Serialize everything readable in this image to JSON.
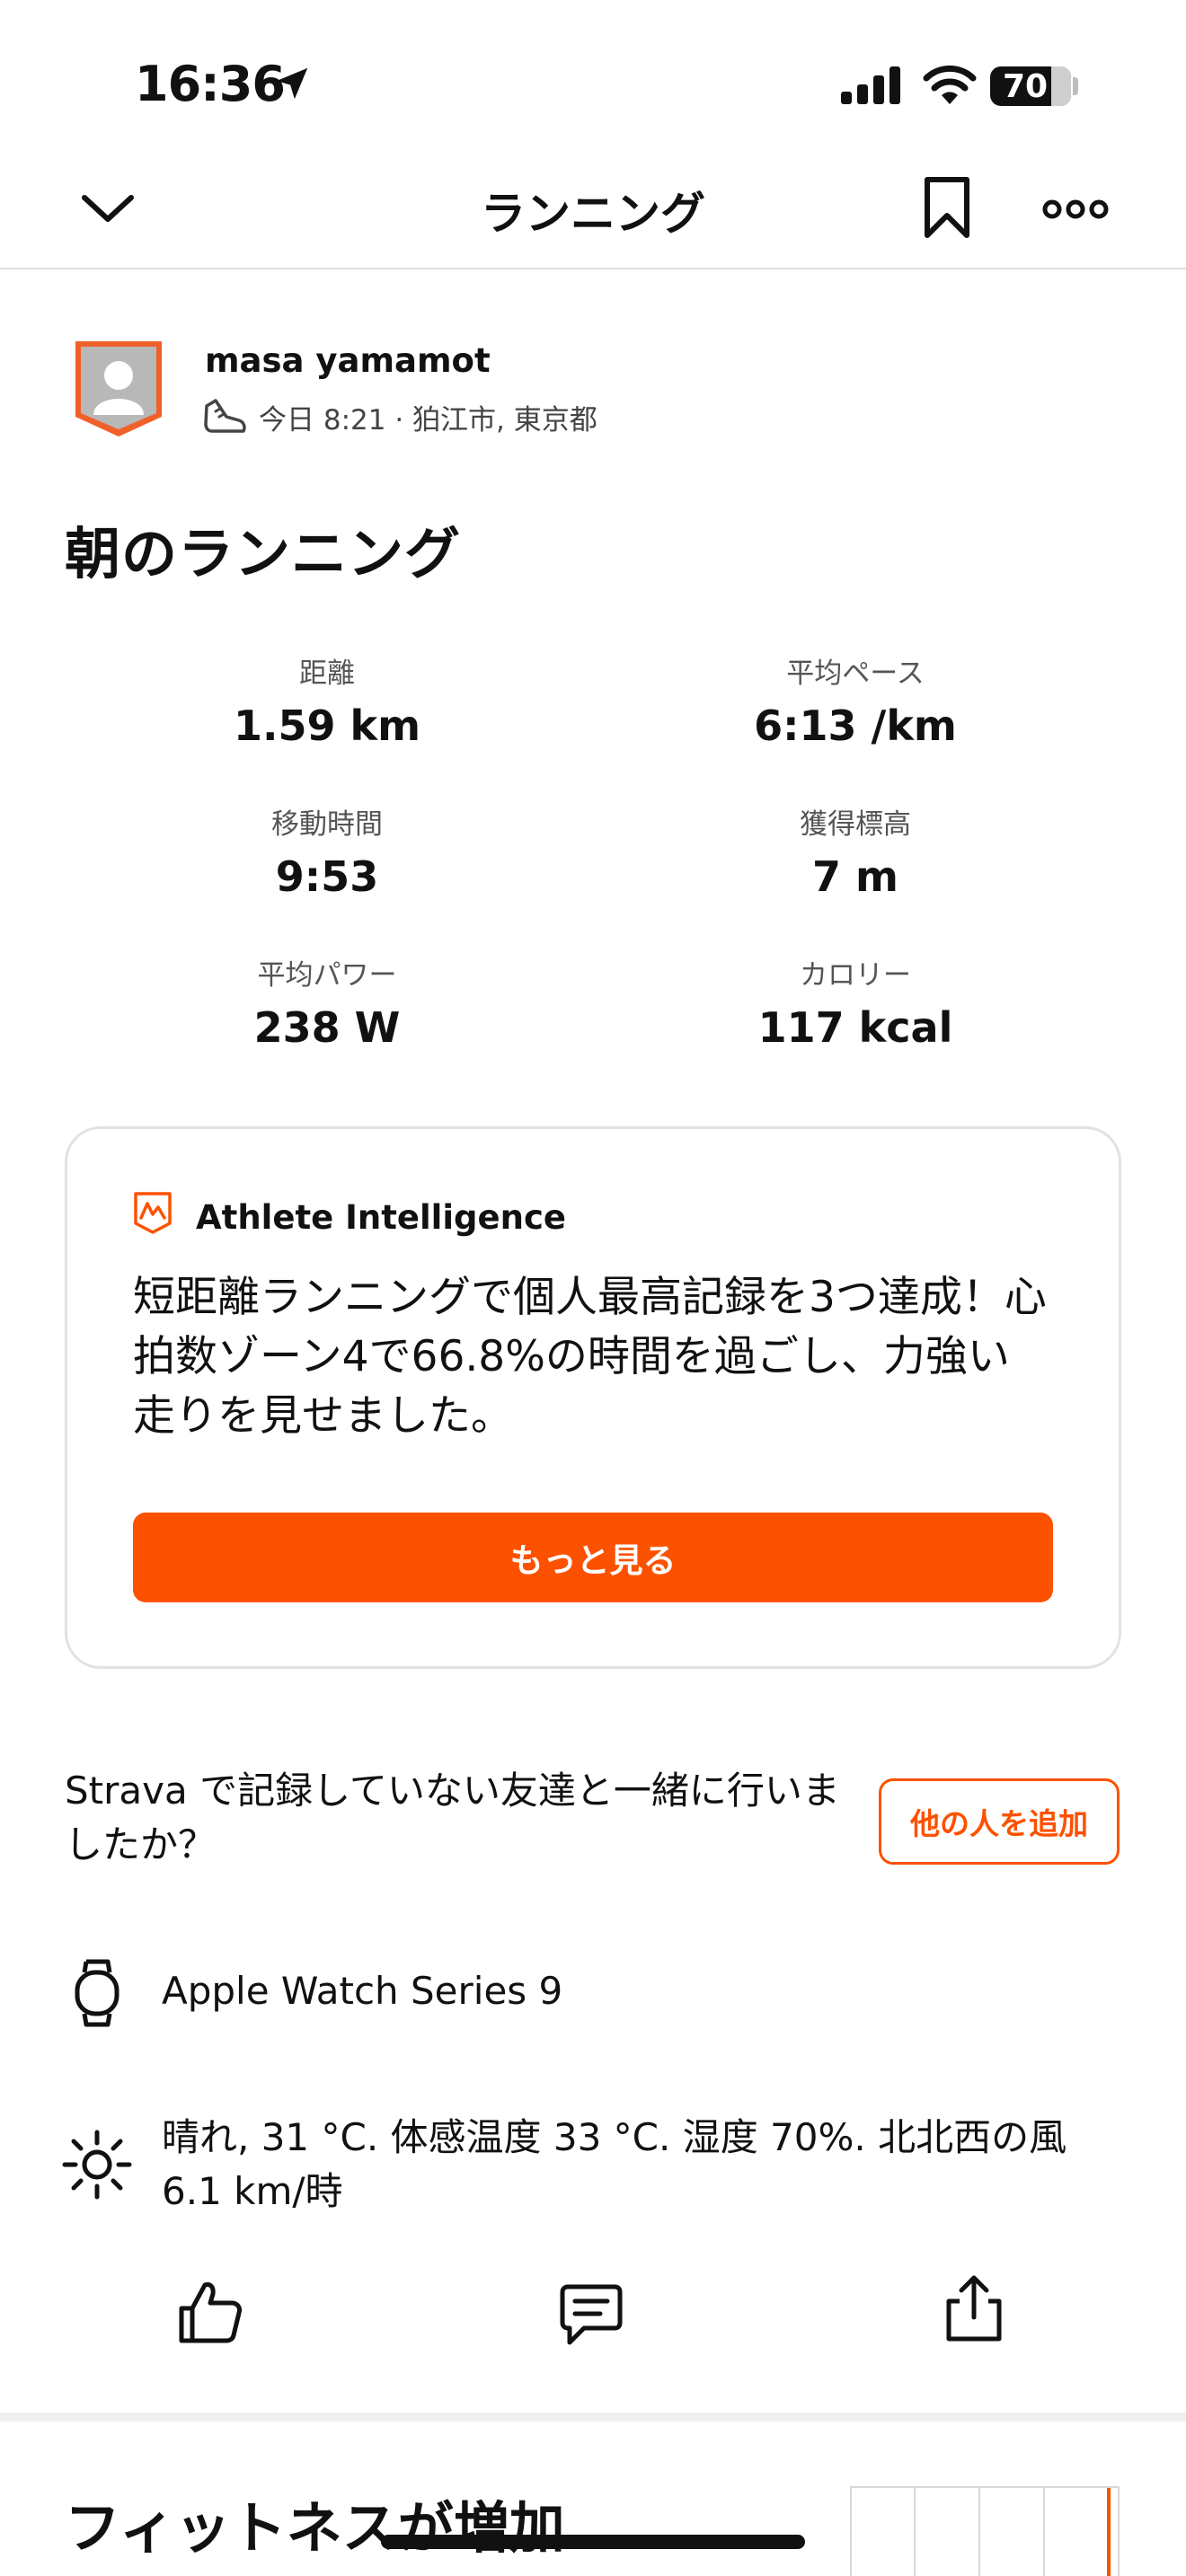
{
  "status_bar": {
    "time": "16:36",
    "battery": "70"
  },
  "topbar": {
    "title": "ランニング"
  },
  "athlete": {
    "name": "masa yamamot",
    "meta": "今日 8:21 · 狛江市, 東京都"
  },
  "activity": {
    "title": "朝のランニング"
  },
  "stats": [
    {
      "label": "距離",
      "value": "1.59 km"
    },
    {
      "label": "平均ペース",
      "value": "6:13 /km"
    },
    {
      "label": "移動時間",
      "value": "9:53"
    },
    {
      "label": "獲得標高",
      "value": "7 m"
    },
    {
      "label": "平均パワー",
      "value": "238 W"
    },
    {
      "label": "カロリー",
      "value": "117 kcal"
    }
  ],
  "ai": {
    "title": "Athlete Intelligence",
    "text": "短距離ランニングで個人最高記録を3つ達成！心拍数ゾーン4で66.8%の時間を過ごし、力強い走りを見せました。",
    "button": "もっと見る"
  },
  "friends": {
    "text": "Strava で記録していない友達と一緒に行いましたか？",
    "button": "他の人を追加"
  },
  "device": {
    "name": "Apple Watch Series 9"
  },
  "weather": {
    "text": "晴れ, 31 °C. 体感温度 33 °C. 湿度 70%. 北北西の風 6.1 km/時"
  },
  "fitness": {
    "title": "フィットネスが増加"
  },
  "colors": {
    "accent": "#fc5200",
    "text": "#111111",
    "muted": "#555555",
    "border": "#e2e2e2"
  },
  "icons": [
    "location-arrow-icon",
    "signal-icon",
    "wifi-icon",
    "battery-icon",
    "chevron-down-icon",
    "bookmark-icon",
    "more-icon",
    "avatar-icon",
    "running-shoe-icon",
    "athlete-intelligence-icon",
    "watch-icon",
    "sun-icon",
    "like-icon",
    "comment-icon",
    "share-icon"
  ]
}
